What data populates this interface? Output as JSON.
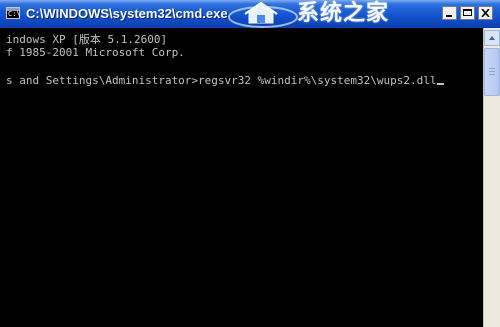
{
  "window": {
    "title": "C:\\WINDOWS\\system32\\cmd.exe",
    "watermark": "系统之家",
    "icon": "cmd-icon"
  },
  "console": {
    "lines": [
      "indows XP [版本 5.1.2600]",
      "f 1985-2001 Microsoft Corp.",
      "s and Settings\\Administrator>regsvr32 %windir%\\system32\\wups2.dll"
    ]
  },
  "colors": {
    "titlebar": "#0f4cc6",
    "console_bg": "#000000",
    "console_text": "#c0c0c0"
  }
}
